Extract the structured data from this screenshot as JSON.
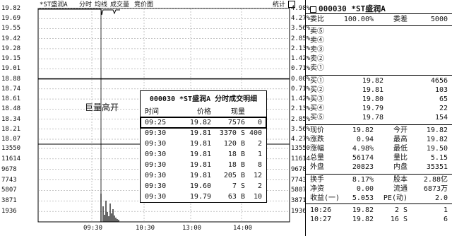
{
  "chart": {
    "header": {
      "name": "*ST盛润A",
      "items": [
        "分时",
        "均线",
        "成交量",
        "竞价图"
      ],
      "stat_label": "统计"
    },
    "price_ticks": [
      "19.82",
      "19.69",
      "19.55",
      "19.42",
      "19.28",
      "19.15",
      "19.01",
      "18.88",
      "18.74",
      "18.61",
      "18.48",
      "18.34",
      "18.21",
      "18.07"
    ],
    "pct_ticks": [
      "4.98%",
      "4.27%",
      "3.56%",
      "2.85%",
      "2.13%",
      "1.42%",
      "0.71%",
      "0.00%",
      "0.71%",
      "1.42%",
      "2.13%",
      "2.85%",
      "3.56%",
      "4.27%"
    ],
    "volume_ticks_left": [
      "13550",
      "11614",
      "9678",
      "7743",
      "5807",
      "3871",
      "1936"
    ],
    "volume_ticks_right": [
      "13550",
      "11614",
      "9678",
      "7743",
      "5807",
      "3871",
      "1936"
    ],
    "time_ticks": [
      "09:30",
      "10:30",
      "13:00",
      "14:00"
    ]
  },
  "detail": {
    "title": "000030 *ST盛润A 分时成交明细",
    "headers": [
      "时间",
      "价格",
      "现量"
    ],
    "rows": [
      [
        "09:25",
        "19.82",
        "7576",
        "",
        "0"
      ],
      [
        "09:30",
        "19.81",
        "3370",
        "S",
        "400"
      ],
      [
        "09:30",
        "19.81",
        "120",
        "B",
        "2"
      ],
      [
        "09:30",
        "19.81",
        "18",
        "B",
        "1"
      ],
      [
        "09:30",
        "19.81",
        "18",
        "B",
        "8"
      ],
      [
        "09:30",
        "19.81",
        "205",
        "B",
        "12"
      ],
      [
        "09:30",
        "19.60",
        "7",
        "S",
        "2"
      ],
      [
        "09:30",
        "19.79",
        "63",
        "B",
        "10"
      ]
    ]
  },
  "callout": "巨量高开",
  "panel": {
    "code": "000030",
    "name": "*ST盛润A",
    "weibi": {
      "l1": "委比",
      "v1": "100.00%",
      "l2": "委差",
      "v2": "5000"
    },
    "sells": [
      {
        "label": "卖⑤",
        "price": "",
        "vol": ""
      },
      {
        "label": "卖④",
        "price": "",
        "vol": ""
      },
      {
        "label": "卖③",
        "price": "",
        "vol": ""
      },
      {
        "label": "卖②",
        "price": "",
        "vol": ""
      },
      {
        "label": "卖①",
        "price": "",
        "vol": ""
      }
    ],
    "buys": [
      {
        "label": "买①",
        "price": "19.82",
        "vol": "4656"
      },
      {
        "label": "买②",
        "price": "19.81",
        "vol": "103"
      },
      {
        "label": "买③",
        "price": "19.80",
        "vol": "65"
      },
      {
        "label": "买④",
        "price": "19.79",
        "vol": "22"
      },
      {
        "label": "买⑤",
        "price": "19.78",
        "vol": "154"
      }
    ],
    "stats": [
      [
        "现价",
        "19.82",
        "今开",
        "19.82"
      ],
      [
        "涨跌",
        "0.94",
        "最高",
        "19.82"
      ],
      [
        "涨幅",
        "4.98%",
        "最低",
        "19.50"
      ],
      [
        "总量",
        "56174",
        "量比",
        "5.15"
      ],
      [
        "外盘",
        "20823",
        "内盘",
        "35351"
      ]
    ],
    "stats2": [
      [
        "换手",
        "8.17%",
        "股本",
        "2.88亿"
      ],
      [
        "净资",
        "0.00",
        "流通",
        "6873万"
      ],
      [
        "收益(一)",
        "5.053",
        "PE(动)",
        "2.0"
      ]
    ],
    "ticks": [
      [
        "10:26",
        "19.82",
        "2",
        "S",
        "1"
      ],
      [
        "10:27",
        "19.82",
        "16",
        "S",
        "6"
      ]
    ]
  }
}
